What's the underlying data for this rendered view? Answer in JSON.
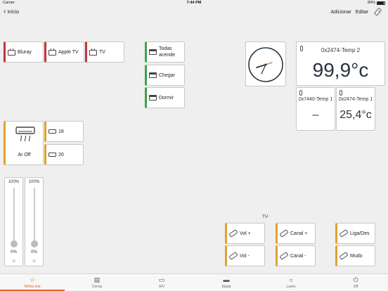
{
  "status_bar": {
    "carrier": "Carrier",
    "time": "7:44 PM",
    "battery": "89%"
  },
  "nav": {
    "back_label": "Início",
    "add_label": "Adicionar",
    "edit_label": "Editar"
  },
  "devices": [
    {
      "label": "Bluray",
      "icon": "tv-icon",
      "accent": "#c0353a"
    },
    {
      "label": "Apple TV",
      "icon": "tv-icon",
      "accent": "#c0353a"
    },
    {
      "label": "TV",
      "icon": "tv-icon",
      "accent": "#c0353a"
    }
  ],
  "scenes": [
    {
      "label": "Todas acende",
      "icon": "scene-icon"
    },
    {
      "label": "Chegar",
      "icon": "scene-icon"
    },
    {
      "label": "Dormir",
      "icon": "scene-icon"
    }
  ],
  "temperature": {
    "main": {
      "label": "0x2474-Temp 2",
      "value": "99,9°c"
    },
    "small_left": {
      "label": "0x7440-Temp 1",
      "value": "–"
    },
    "small_right": {
      "label": "0x2474-Temp 1",
      "value": "25,4°c"
    }
  },
  "ac": {
    "main_label": "Ar Off",
    "setpoints": [
      {
        "label": "18"
      },
      {
        "label": "20"
      }
    ]
  },
  "dimmers": [
    {
      "max_label": "100%",
      "min_label": "0%",
      "level": 0
    },
    {
      "max_label": "100%",
      "min_label": "0%",
      "level": 0
    }
  ],
  "tv_remote": {
    "section_label": "TV",
    "buttons": [
      {
        "label": "Vol +"
      },
      {
        "label": "Canal +"
      },
      {
        "label": "Liga/Des"
      },
      {
        "label": "Vol -"
      },
      {
        "label": "Canal -"
      },
      {
        "label": "Mudo"
      }
    ]
  },
  "tabs": [
    {
      "label": "Minha tela",
      "icon": "star-icon",
      "active": true
    },
    {
      "label": "Cenas",
      "icon": "scene-icon",
      "active": false
    },
    {
      "label": "A/V",
      "icon": "tv-icon",
      "active": false
    },
    {
      "label": "Equip",
      "icon": "ac-icon",
      "active": false
    },
    {
      "label": "Luzes",
      "icon": "bulb-icon",
      "active": false
    },
    {
      "label": "Off",
      "icon": "power-icon",
      "active": false
    }
  ],
  "colors": {
    "accent_active": "#e8632d",
    "device_red": "#c0353a",
    "scene_green": "#3aa34a",
    "equip_yellow": "#e0a22c"
  }
}
